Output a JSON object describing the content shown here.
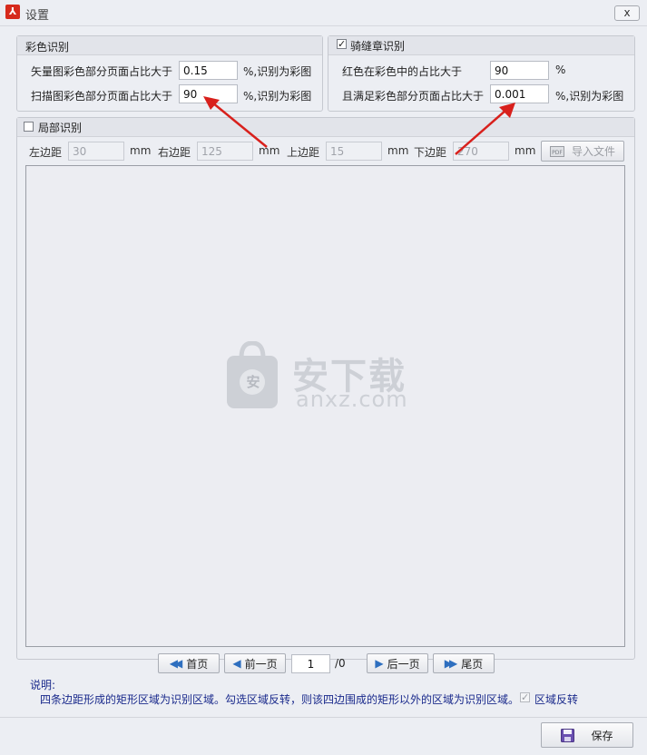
{
  "window": {
    "title": "设置",
    "close_label": "x"
  },
  "color_recognition": {
    "title": "彩色识别",
    "vector_label": "矢量图彩色部分页面占比大于",
    "vector_value": "0.15",
    "vector_suffix": "%,识别为彩图",
    "scan_label": "扫描图彩色部分页面占比大于",
    "scan_value": "90",
    "scan_suffix": "%,识别为彩图"
  },
  "seam_stamp": {
    "title": "骑缝章识别",
    "checked": true,
    "red_label": "红色在彩色中的占比大于",
    "red_value": "90",
    "red_suffix": "%",
    "color_label": "且满足彩色部分页面占比大于",
    "color_value": "0.001",
    "color_suffix": "%,识别为彩图"
  },
  "local_recognition": {
    "title": "局部识别",
    "checked": false,
    "left_label": "左边距",
    "left_value": "30",
    "left_unit": "mm",
    "right_label": "右边距",
    "right_value": "125",
    "right_unit": "mm",
    "top_label": "上边距",
    "top_value": "15",
    "top_unit": "mm",
    "bottom_label": "下边距",
    "bottom_value": "270",
    "bottom_unit": "mm",
    "import_label": "导入文件"
  },
  "watermark": {
    "main": "安下载",
    "sub": "anxz.com",
    "badge": "安"
  },
  "pager": {
    "first": "首页",
    "prev": "前一页",
    "page_value": "1",
    "total": "/0",
    "next": "后一页",
    "last": "尾页"
  },
  "notes": {
    "heading": "说明:",
    "text": "四条边距形成的矩形区域为识别区域。勾选区域反转，则该四边围成的矩形以外的区域为识别区域。",
    "invert_label": "区域反转",
    "invert_checked": true
  },
  "footer": {
    "save_label": "保存"
  },
  "colors": {
    "arrow": "#d8201c",
    "note_text": "#1a2a8c",
    "nav_arrow": "#2e6fbf"
  }
}
